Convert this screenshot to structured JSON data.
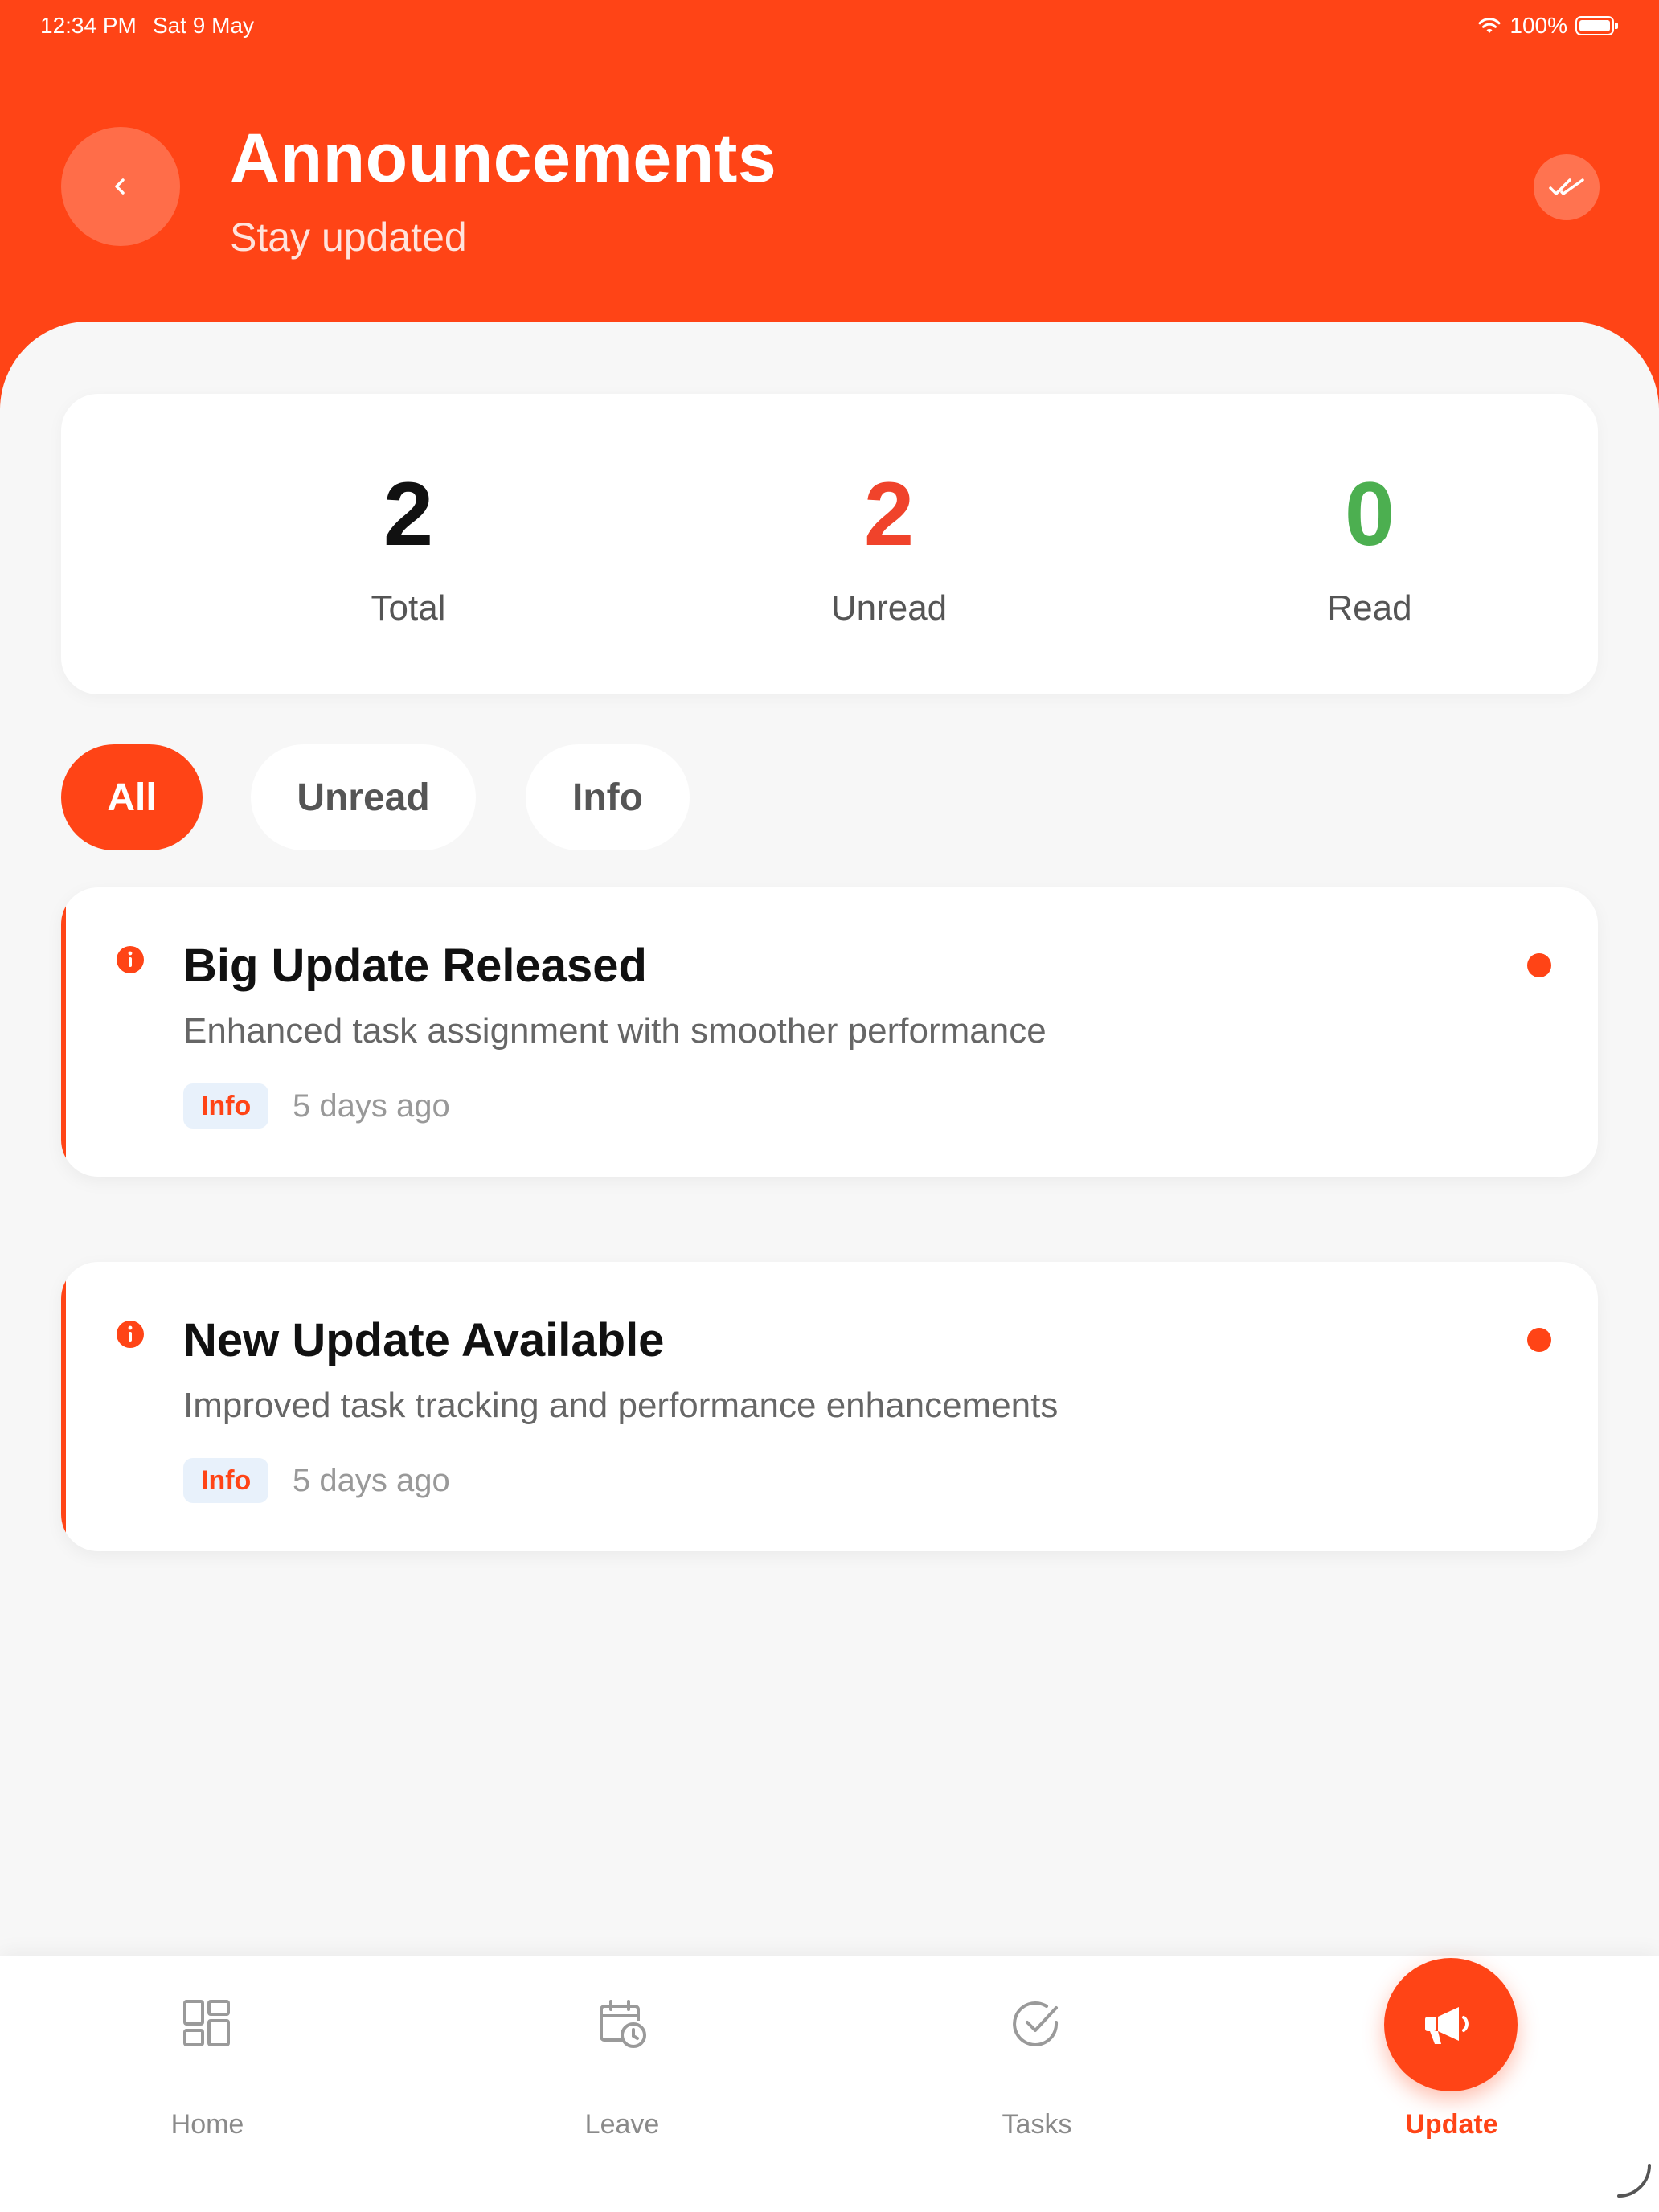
{
  "status_bar": {
    "time": "12:34 PM",
    "date": "Sat 9 May",
    "battery": "100%"
  },
  "header": {
    "title": "Announcements",
    "subtitle": "Stay updated"
  },
  "stats": [
    {
      "value": "2",
      "label": "Total",
      "color": "#111111"
    },
    {
      "value": "2",
      "label": "Unread",
      "color": "#f0432b"
    },
    {
      "value": "0",
      "label": "Read",
      "color": "#4caf50"
    }
  ],
  "filters": {
    "all": "All",
    "unread": "Unread",
    "info": "Info",
    "active": "All"
  },
  "announcements": [
    {
      "title": "Big Update Released",
      "description": "Enhanced task assignment with smoother performance",
      "tag": "Info",
      "time": "5 days ago",
      "unread": true
    },
    {
      "title": "New Update Available",
      "description": "Improved task tracking and performance enhancements",
      "tag": "Info",
      "time": "5 days ago",
      "unread": true
    }
  ],
  "bottom_nav": {
    "items": [
      {
        "label": "Home",
        "icon": "grid-icon"
      },
      {
        "label": "Leave",
        "icon": "calendar-clock-icon"
      },
      {
        "label": "Tasks",
        "icon": "check-circle-icon"
      },
      {
        "label": "Update",
        "icon": "megaphone-icon"
      }
    ],
    "active": "Update"
  },
  "colors": {
    "accent": "#ff4416",
    "background": "#f7f7f7",
    "badge_bg": "#e8f1fb"
  }
}
